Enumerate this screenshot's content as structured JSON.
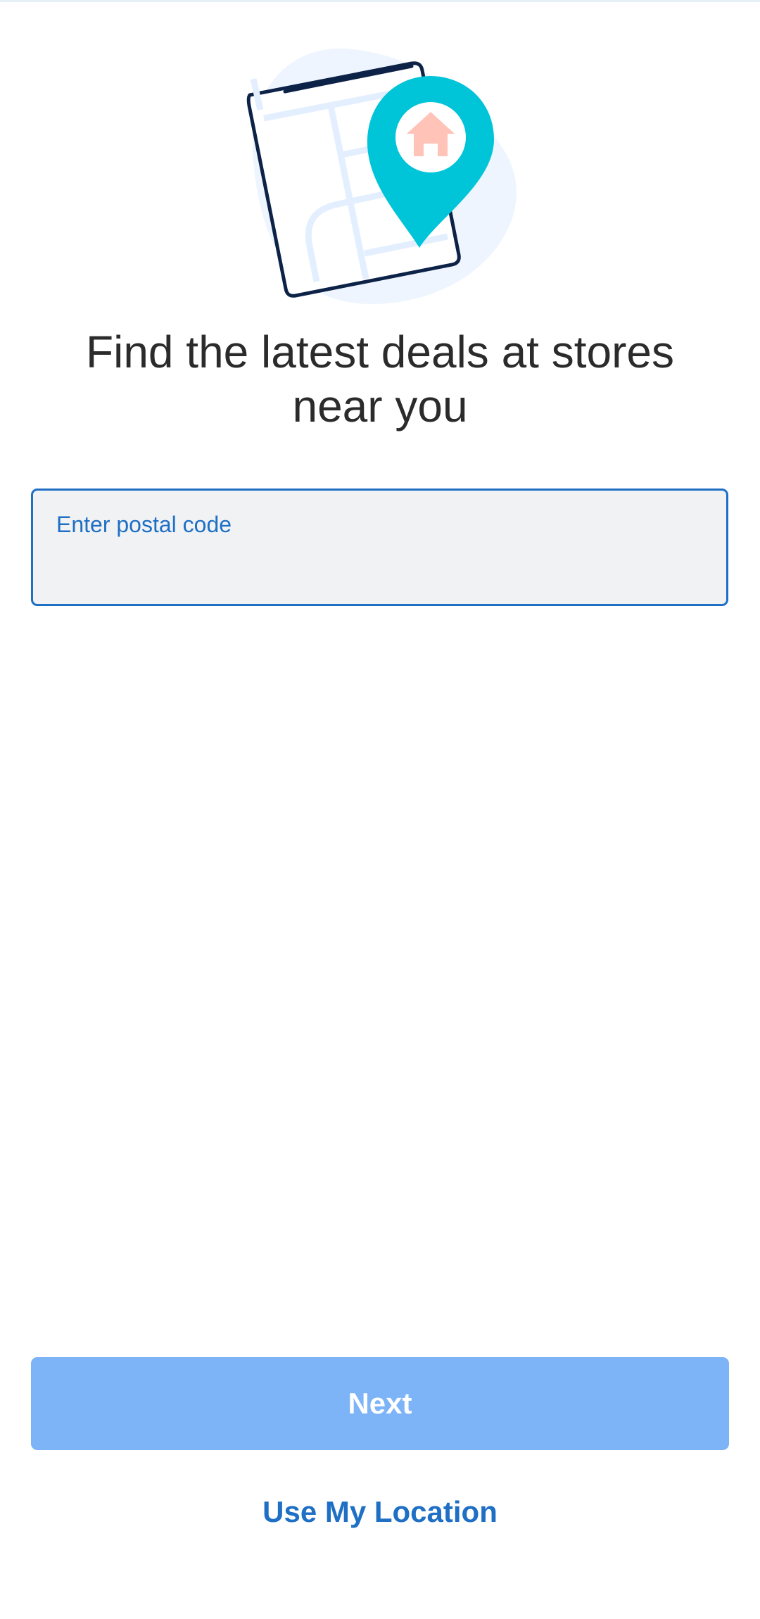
{
  "headline": "Find the latest deals at stores near you",
  "postal_field": {
    "label": "Enter postal code",
    "value": ""
  },
  "next_button": {
    "label": "Next"
  },
  "use_location": {
    "label": "Use My Location"
  },
  "illustration": {
    "icon": "map-location-pin-icon",
    "colors": {
      "pin": "#00c4d8",
      "house": "#ffc3b8",
      "map_outline": "#0d2247",
      "map_roads": "#e3efff",
      "background_blob": "#eef5fe"
    }
  },
  "colors": {
    "accent": "#1f6fc5",
    "button_disabled": "#7db3f7",
    "field_background": "#f0f2f4",
    "text": "#2b2b2b"
  }
}
